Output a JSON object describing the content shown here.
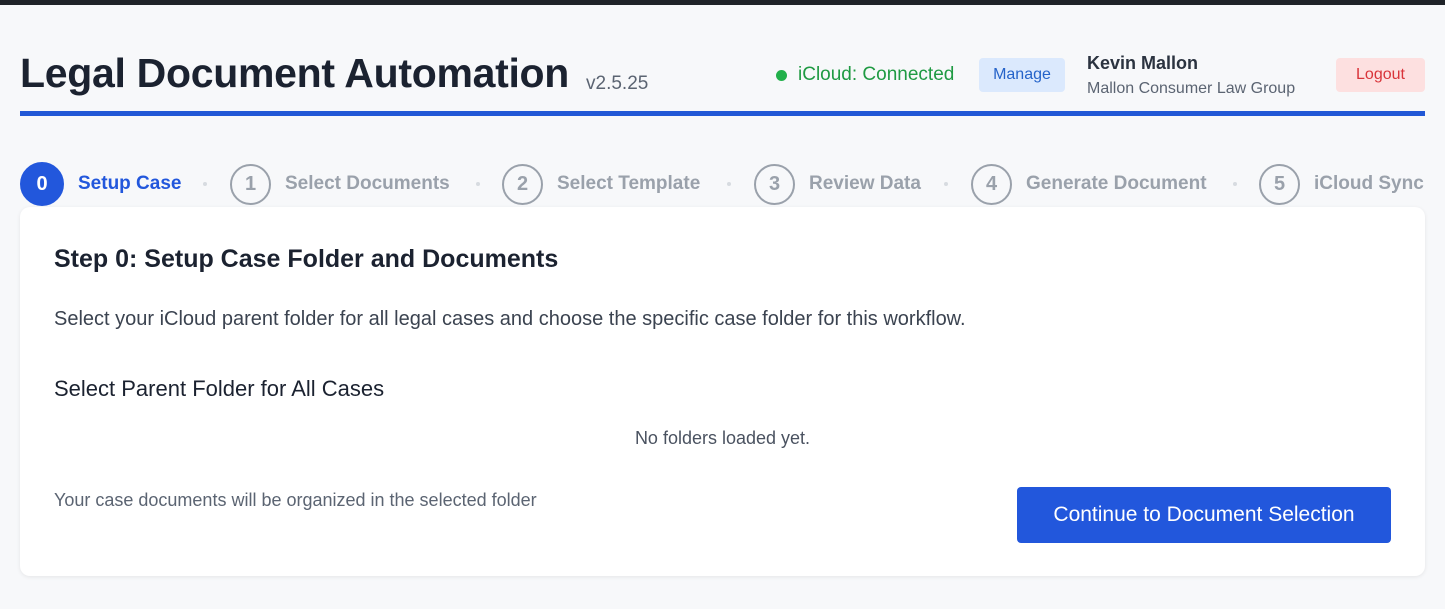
{
  "header": {
    "title": "Legal Document Automation",
    "version": "v2.5.25",
    "icloud_status": "iCloud: Connected",
    "manage_label": "Manage",
    "user_name": "Kevin Mallon",
    "user_org": "Mallon Consumer Law Group",
    "logout_label": "Logout"
  },
  "stepper": {
    "steps": [
      {
        "number": "0",
        "label": "Setup Case",
        "active": true
      },
      {
        "number": "1",
        "label": "Select Documents",
        "active": false
      },
      {
        "number": "2",
        "label": "Select Template",
        "active": false
      },
      {
        "number": "3",
        "label": "Review Data",
        "active": false
      },
      {
        "number": "4",
        "label": "Generate Document",
        "active": false
      },
      {
        "number": "5",
        "label": "iCloud Sync",
        "active": false
      }
    ]
  },
  "main": {
    "title": "Step 0: Setup Case Folder and Documents",
    "description": "Select your iCloud parent folder for all legal cases and choose the specific case folder for this workflow.",
    "section_title": "Select Parent Folder for All Cases",
    "empty_state": "No folders loaded yet.",
    "footer_note": "Your case documents will be organized in the selected folder",
    "continue_label": "Continue to Document Selection"
  },
  "colors": {
    "accent": "#2257dc",
    "status_connected": "#1f9a43",
    "logout": "#d9343a"
  },
  "icons": {
    "status": "status-dot-icon"
  }
}
